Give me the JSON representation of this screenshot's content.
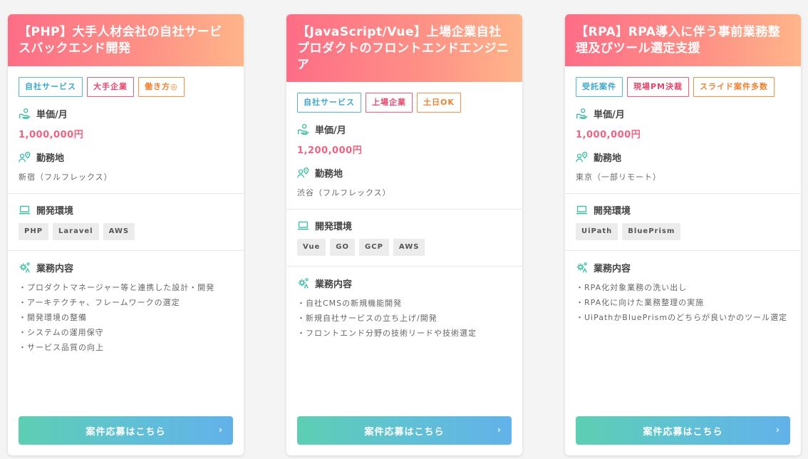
{
  "colors": {
    "header_gradient": [
      "#fd6d86",
      "#ffb589"
    ],
    "button_gradient": [
      "#5dcfb3",
      "#62b2ea"
    ],
    "price": "#f2627f",
    "icon_teal": "#3cbea3"
  },
  "labels": {
    "price": "単価/月",
    "location": "勤務地",
    "env": "開発環境",
    "work": "業務内容",
    "apply": "案件応募はこちら",
    "chevron": "›"
  },
  "icons": {
    "price": "hand-coin-icon",
    "location": "person-pin-icon",
    "env": "laptop-icon",
    "work": "gears-icon"
  },
  "jobs": [
    {
      "title": "【PHP】大手人材会社の自社サービスバックエンド開発",
      "tags": [
        {
          "text": "自社サービス",
          "color": "blue"
        },
        {
          "text": "大手企業",
          "color": "red"
        },
        {
          "text": "働き方◎",
          "color": "orange"
        }
      ],
      "price": "1,000,000円",
      "location": "新宿（フルフレックス）",
      "env": [
        "PHP",
        "Laravel",
        "AWS"
      ],
      "work": [
        "・プロダクトマネージャー等と連携した設計・開発",
        "・アーキテクチャ、フレームワークの選定",
        "・開発環境の整備",
        "・システムの運用保守",
        "・サービス品質の向上"
      ]
    },
    {
      "title": "【JavaScript/Vue】上場企業自社プロダクトのフロントエンドエンジニア",
      "tags": [
        {
          "text": "自社サービス",
          "color": "blue"
        },
        {
          "text": "上場企業",
          "color": "red"
        },
        {
          "text": "土日OK",
          "color": "orange"
        }
      ],
      "price": "1,200,000円",
      "location": "渋谷（フルフレックス）",
      "env": [
        "Vue",
        "GO",
        "GCP",
        "AWS"
      ],
      "work": [
        "・自社CMSの新規機能開発",
        "・新規自社サービスの立ち上げ/開発",
        "・フロントエンド分野の技術リードや技術選定"
      ]
    },
    {
      "title": "【RPA】RPA導入に伴う事前業務整理及びツール選定支援",
      "tags": [
        {
          "text": "受託案件",
          "color": "blue"
        },
        {
          "text": "現場PM決裁",
          "color": "red"
        },
        {
          "text": "スライド案件多数",
          "color": "orange"
        }
      ],
      "price": "1,000,000円",
      "location": "東京（一部リモート）",
      "env": [
        "UiPath",
        "BluePrism"
      ],
      "work": [
        "・RPA化対象業務の洗い出し",
        "・RPA化に向けた業務整理の実施",
        "・UiPathかBluePrismのどちらが良いかのツール選定"
      ]
    }
  ]
}
